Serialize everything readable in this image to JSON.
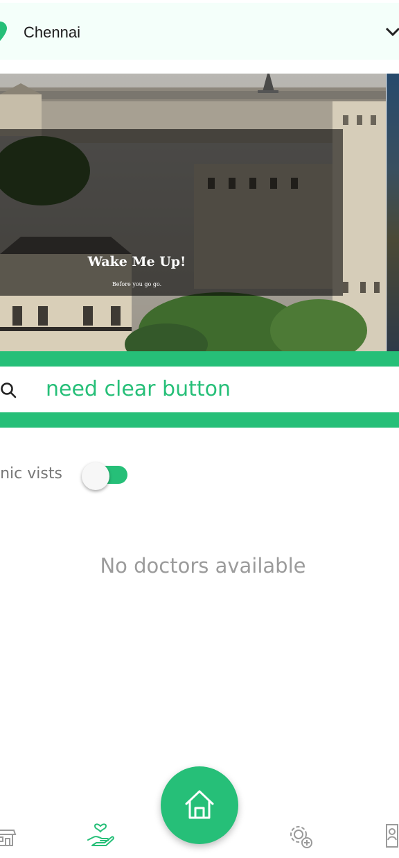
{
  "location": {
    "city": "Chennai"
  },
  "banner": {
    "title": "Wake Me Up!",
    "subtitle": "Before you go go."
  },
  "search": {
    "value": "need clear button"
  },
  "filter": {
    "label": "inic vists",
    "enabled": true
  },
  "results": {
    "empty_message": "No doctors available"
  },
  "bottom_nav": {
    "items": [
      "shop-icon",
      "care-icon",
      "home-icon",
      "settings-icon",
      "profile-icon"
    ],
    "active": "care-icon"
  },
  "colors": {
    "accent": "#26bf78",
    "header_bg": "#f4fffa",
    "muted_text": "#9b9b9b"
  }
}
